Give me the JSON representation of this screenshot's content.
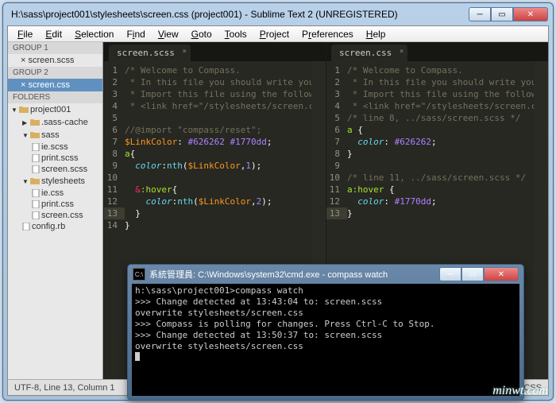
{
  "window": {
    "title": "H:\\sass\\project001\\stylesheets\\screen.css (project001) - Sublime Text 2 (UNREGISTERED)"
  },
  "menu": [
    "File",
    "Edit",
    "Selection",
    "Find",
    "View",
    "Goto",
    "Tools",
    "Project",
    "Preferences",
    "Help"
  ],
  "sidebar": {
    "group1": "GROUP 1",
    "group1_item": "screen.scss",
    "group2": "GROUP 2",
    "group2_item": "screen.css",
    "folders_hdr": "FOLDERS",
    "nodes": {
      "project": "project001",
      "sasscache": ".sass-cache",
      "sass": "sass",
      "ie_scss": "ie.scss",
      "print_scss": "print.scss",
      "screen_scss": "screen.scss",
      "stylesheets": "stylesheets",
      "ie_css": "ie.css",
      "print_css": "print.css",
      "screen_css": "screen.css",
      "config": "config.rb"
    }
  },
  "tabs": {
    "left": "screen.scss",
    "right": "screen.css"
  },
  "status": {
    "left": "UTF-8, Line 13, Column 1",
    "right": "CSS"
  },
  "cmd": {
    "title": "系統管理員: C:\\Windows\\system32\\cmd.exe - compass  watch",
    "lines": [
      "h:\\sass\\project001>compass watch",
      ">>> Change detected at 13:43:04 to: screen.scss",
      "overwrite stylesheets/screen.css",
      ">>> Compass is polling for changes. Press Ctrl-C to Stop.",
      ">>> Change detected at 13:50:37 to: screen.scss",
      "overwrite stylesheets/screen.css"
    ]
  },
  "watermark": "minwt.com"
}
